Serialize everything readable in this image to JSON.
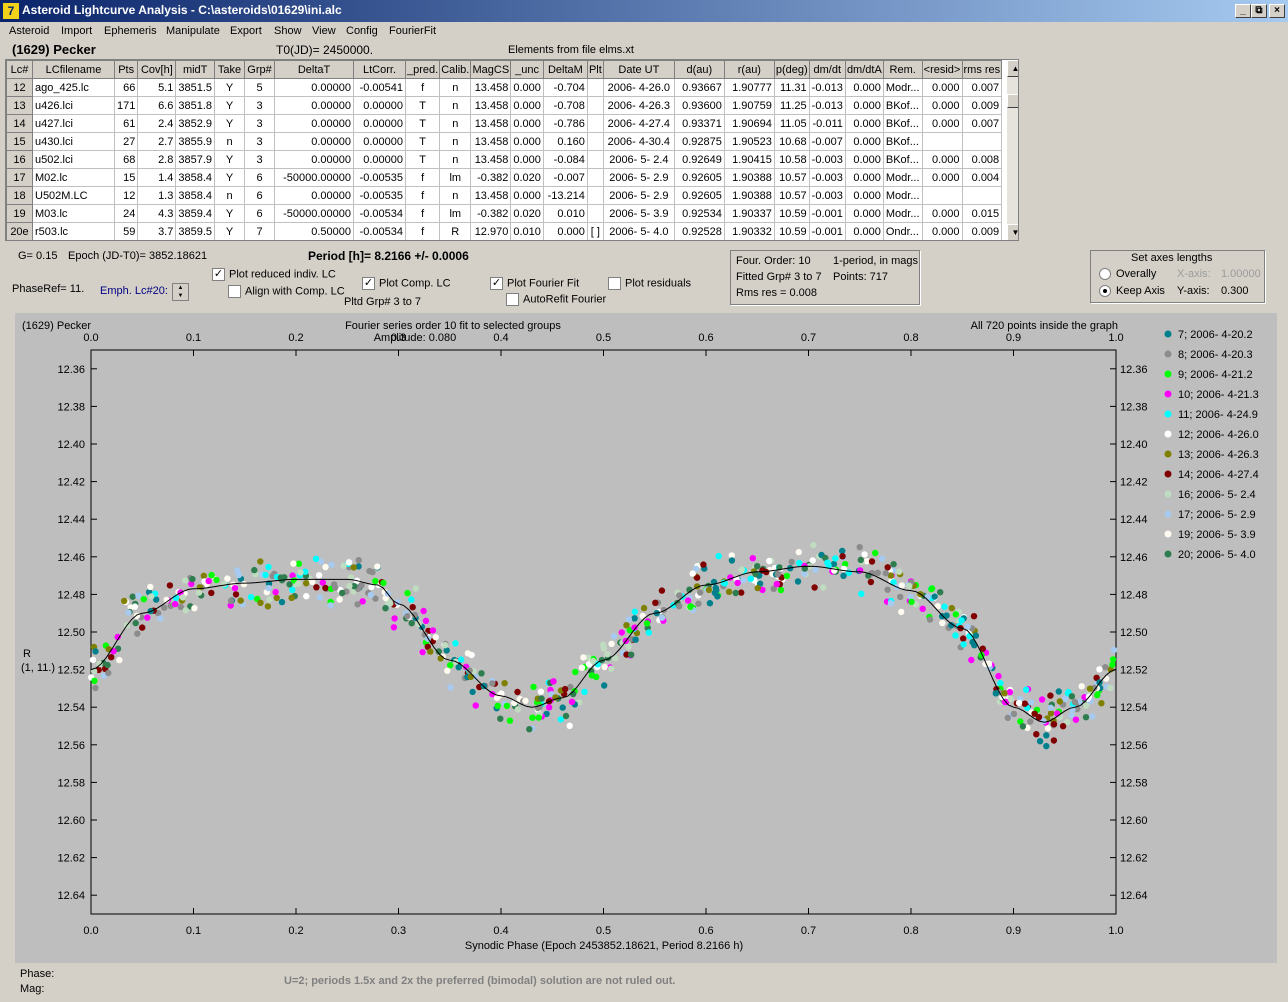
{
  "window": {
    "title": "Asteroid Lightcurve Analysis - C:\\asteroids\\01629\\ini.alc",
    "minimize": "_",
    "restore": "⧉",
    "close": "×",
    "icon": "7"
  },
  "menu": [
    "Asteroid",
    "Import",
    "Ephemeris",
    "Manipulate",
    "Export",
    "Show",
    "View",
    "Config",
    "FourierFit"
  ],
  "header": {
    "asteroid": "(1629) Pecker",
    "t0": "T0(JD)= 2450000.",
    "elements": "Elements from file elms.xt"
  },
  "table": {
    "columns": [
      "Lc#",
      "LCfilename",
      "Pts",
      "Cov[h]",
      "midT",
      "Take",
      "Grp#",
      "DeltaT",
      "LtCorr.",
      "_pred.",
      "Calib.",
      "MagCS",
      "_unc",
      "DeltaM",
      "Plt",
      "Date UT",
      "d(au)",
      "r(au)",
      "p(deg)",
      "dm/dt",
      "dm/dtA",
      "Rem.",
      "<resid>",
      "rms res"
    ],
    "rows": [
      [
        "12",
        "ago_425.lc",
        "66",
        "5.1",
        "3851.5",
        "Y",
        "5",
        "0.00000",
        "-0.00541",
        "f",
        "n",
        "13.458",
        "0.000",
        "-0.704",
        "",
        "2006- 4-26.0",
        "0.93667",
        "1.90777",
        "11.31",
        "-0.013",
        "0.000",
        "Modr...",
        "0.000",
        "0.007"
      ],
      [
        "13",
        "u426.lci",
        "171",
        "6.6",
        "3851.8",
        "Y",
        "3",
        "0.00000",
        "0.00000",
        "T",
        "n",
        "13.458",
        "0.000",
        "-0.708",
        "",
        "2006- 4-26.3",
        "0.93600",
        "1.90759",
        "11.25",
        "-0.013",
        "0.000",
        "BKof...",
        "0.000",
        "0.009"
      ],
      [
        "14",
        "u427.lci",
        "61",
        "2.4",
        "3852.9",
        "Y",
        "3",
        "0.00000",
        "0.00000",
        "T",
        "n",
        "13.458",
        "0.000",
        "-0.786",
        "",
        "2006- 4-27.4",
        "0.93371",
        "1.90694",
        "11.05",
        "-0.011",
        "0.000",
        "BKof...",
        "0.000",
        "0.007"
      ],
      [
        "15",
        "u430.lci",
        "27",
        "2.7",
        "3855.9",
        "n",
        "3",
        "0.00000",
        "0.00000",
        "T",
        "n",
        "13.458",
        "0.000",
        "0.160",
        "",
        "2006- 4-30.4",
        "0.92875",
        "1.90523",
        "10.68",
        "-0.007",
        "0.000",
        "BKof...",
        "",
        ""
      ],
      [
        "16",
        "u502.lci",
        "68",
        "2.8",
        "3857.9",
        "Y",
        "3",
        "0.00000",
        "0.00000",
        "T",
        "n",
        "13.458",
        "0.000",
        "-0.084",
        "",
        "2006- 5- 2.4",
        "0.92649",
        "1.90415",
        "10.58",
        "-0.003",
        "0.000",
        "BKof...",
        "0.000",
        "0.008"
      ],
      [
        "17",
        "M02.lc",
        "15",
        "1.4",
        "3858.4",
        "Y",
        "6",
        "-50000.00000",
        "-0.00535",
        "f",
        "lm",
        "-0.382",
        "0.020",
        "-0.007",
        "",
        "2006- 5- 2.9",
        "0.92605",
        "1.90388",
        "10.57",
        "-0.003",
        "0.000",
        "Modr...",
        "0.000",
        "0.004"
      ],
      [
        "18",
        "U502M.LC",
        "12",
        "1.3",
        "3858.4",
        "n",
        "6",
        "0.00000",
        "-0.00535",
        "f",
        "n",
        "13.458",
        "0.000",
        "-13.214",
        "",
        "2006- 5- 2.9",
        "0.92605",
        "1.90388",
        "10.57",
        "-0.003",
        "0.000",
        "Modr...",
        "",
        ""
      ],
      [
        "19",
        "M03.lc",
        "24",
        "4.3",
        "3859.4",
        "Y",
        "6",
        "-50000.00000",
        "-0.00534",
        "f",
        "lm",
        "-0.382",
        "0.020",
        "0.010",
        "",
        "2006- 5- 3.9",
        "0.92534",
        "1.90337",
        "10.59",
        "-0.001",
        "0.000",
        "Modr...",
        "0.000",
        "0.015"
      ],
      [
        "20e",
        "r503.lc",
        "59",
        "3.7",
        "3859.5",
        "Y",
        "7",
        "0.50000",
        "-0.00534",
        "f",
        "R",
        "12.970",
        "0.010",
        "0.000",
        "[ ]",
        "2006- 5- 4.0",
        "0.92528",
        "1.90332",
        "10.59",
        "-0.001",
        "0.000",
        "Ondr...",
        "0.000",
        "0.009"
      ]
    ]
  },
  "controls": {
    "g": "G= 0.15",
    "epoch": "Epoch (JD-T0)= 3852.18621",
    "period": "Period [h]= 8.2166 +/- 0.0006",
    "phaseref": "PhaseRef= 11.",
    "emph": "Emph. Lc#20:",
    "plot_reduced": "Plot reduced indiv. LC",
    "align": "Align with Comp. LC",
    "plot_comp": "Plot Comp. LC",
    "pltd_grp": "Pltd Grp#  3  to  7",
    "plot_fourier": "Plot Fourier Fit",
    "autorefit": "AutoRefit Fourier",
    "plot_residuals": "Plot residuals",
    "checked": {
      "plot_reduced": true,
      "align": false,
      "plot_comp": true,
      "plot_fourier": true,
      "autorefit": false,
      "plot_residuals": false
    }
  },
  "fourier_info": {
    "order": "Four. Order: 10",
    "mode": "1-period, in mags",
    "fitted": "Fitted Grp# 3 to 7",
    "points": "Points: 717",
    "rms": "Rms res     = 0.008"
  },
  "axes_box": {
    "title": "Set axes lengths",
    "overally": "Overally",
    "keep": "Keep Axis",
    "xaxis_label": "X-axis:",
    "xaxis_value": "1.00000",
    "yaxis_label": "Y-axis:",
    "yaxis_value": "0.300",
    "selected": "keep"
  },
  "plot": {
    "name": "(1629) Pecker",
    "subtitle": "Fourier series order 10 fit to selected groups",
    "amplitude": "Amplitude: 0.080",
    "inside": "All 720 points inside the graph",
    "ylabel_line1": "R",
    "ylabel_line2": "(1, 11.)",
    "xlabel": "Synodic Phase (Epoch 2453852.18621, Period 8.2166 h)",
    "bg": "#bebebe"
  },
  "chart_data": {
    "type": "scatter",
    "x_ticks": [
      "0.0",
      "0.1",
      "0.2",
      "0.3",
      "0.4",
      "0.5",
      "0.6",
      "0.7",
      "0.8",
      "0.9",
      "1.0"
    ],
    "y_ticks": [
      "12.36",
      "12.38",
      "12.40",
      "12.42",
      "12.44",
      "12.46",
      "12.48",
      "12.50",
      "12.52",
      "12.54",
      "12.56",
      "12.58",
      "12.60",
      "12.62",
      "12.64"
    ],
    "xlim": [
      0.0,
      1.0
    ],
    "ylim": [
      12.65,
      12.35
    ],
    "y_inverted": true,
    "fit_curve": {
      "x": [
        0.0,
        0.05,
        0.1,
        0.15,
        0.2,
        0.25,
        0.28,
        0.3,
        0.35,
        0.4,
        0.43,
        0.46,
        0.5,
        0.55,
        0.6,
        0.65,
        0.7,
        0.75,
        0.8,
        0.85,
        0.9,
        0.93,
        0.96,
        1.0
      ],
      "y": [
        12.52,
        12.49,
        12.477,
        12.474,
        12.472,
        12.472,
        12.475,
        12.485,
        12.515,
        12.534,
        12.54,
        12.535,
        12.515,
        12.49,
        12.475,
        12.468,
        12.465,
        12.468,
        12.478,
        12.498,
        12.54,
        12.548,
        12.54,
        12.52
      ]
    },
    "series": [
      {
        "name": "7; 2006- 4-20.2",
        "color": "#00808c"
      },
      {
        "name": "8; 2006- 4-20.3",
        "color": "#8c8c8c"
      },
      {
        "name": "9; 2006- 4-21.2",
        "color": "#00ff00"
      },
      {
        "name": "10; 2006- 4-21.3",
        "color": "#ff00ff"
      },
      {
        "name": "11; 2006- 4-24.9",
        "color": "#00ffff"
      },
      {
        "name": "12; 2006- 4-26.0",
        "color": "#ffffff"
      },
      {
        "name": "13; 2006- 4-26.3",
        "color": "#808000"
      },
      {
        "name": "14; 2006- 4-27.4",
        "color": "#800000"
      },
      {
        "name": "16; 2006- 5- 2.4",
        "color": "#c0dcc0"
      },
      {
        "name": "17; 2006- 5- 2.9",
        "color": "#a6caf0"
      },
      {
        "name": "19; 2006- 5- 3.9",
        "color": "#fffbf0"
      },
      {
        "name": "20; 2006- 5- 4.0",
        "color": "#2e7d4f"
      }
    ],
    "title": "Fourier series order 10 fit to selected groups"
  },
  "footer": {
    "phase": "Phase:",
    "mag": "Mag:",
    "note": "U=2; periods 1.5x and 2x the preferred (bimodal) solution are not ruled out."
  }
}
